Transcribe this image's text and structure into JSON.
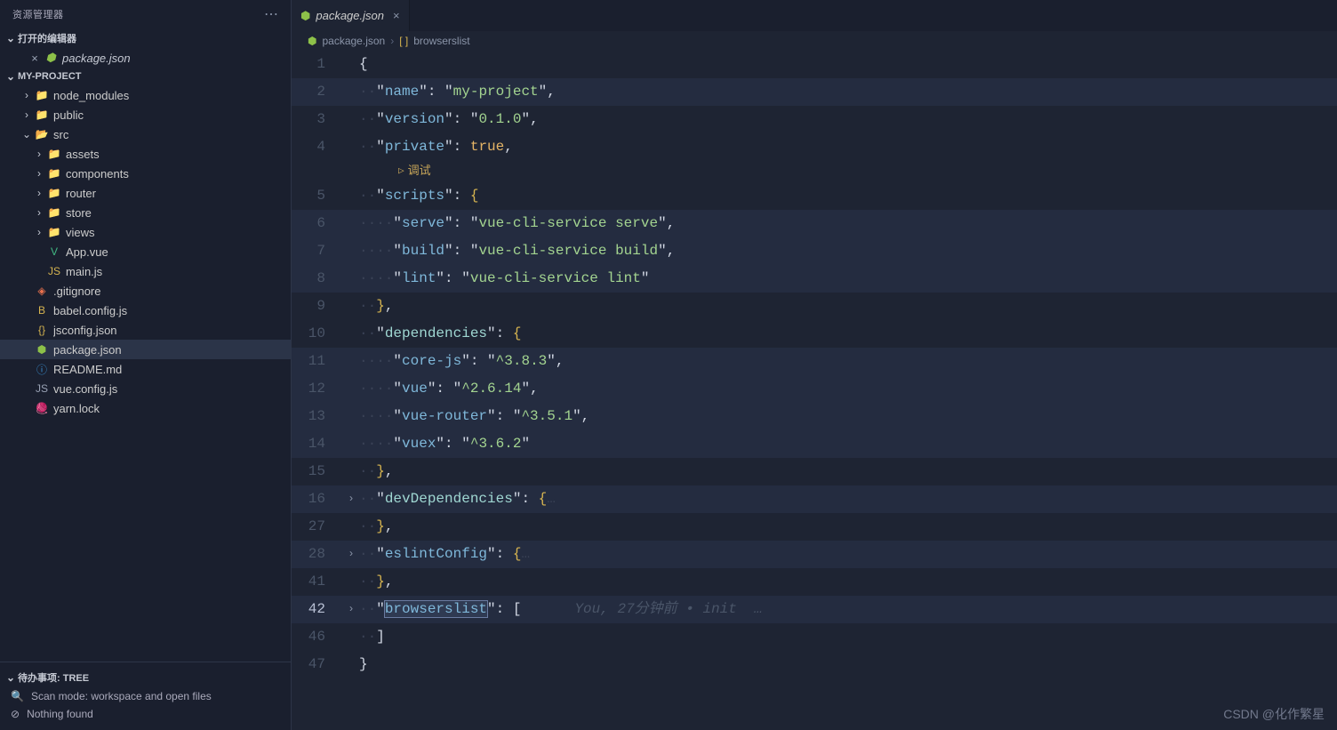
{
  "sidebar": {
    "title": "资源管理器",
    "open_editors_label": "打开的编辑器",
    "open_editor_file": "package.json",
    "project_name": "MY-PROJECT",
    "tree": [
      {
        "indent": 1,
        "chev": ">",
        "icon": "folder",
        "color": "#55b581",
        "label": "node_modules"
      },
      {
        "indent": 1,
        "chev": ">",
        "icon": "folder",
        "color": "#3a93d6",
        "label": "public"
      },
      {
        "indent": 1,
        "chev": "v",
        "icon": "folder-open",
        "color": "#55b581",
        "label": "src"
      },
      {
        "indent": 2,
        "chev": ">",
        "icon": "folder",
        "color": "#d6b450",
        "label": "assets"
      },
      {
        "indent": 2,
        "chev": ">",
        "icon": "folder",
        "color": "#d6b450",
        "label": "components"
      },
      {
        "indent": 2,
        "chev": ">",
        "icon": "folder",
        "color": "#55b581",
        "label": "router"
      },
      {
        "indent": 2,
        "chev": ">",
        "icon": "folder",
        "color": "#d6b450",
        "label": "store"
      },
      {
        "indent": 2,
        "chev": ">",
        "icon": "folder",
        "color": "#d6b450",
        "label": "views"
      },
      {
        "indent": 2,
        "chev": "",
        "icon": "vue",
        "color": "#41b883",
        "label": "App.vue"
      },
      {
        "indent": 2,
        "chev": "",
        "icon": "js",
        "color": "#d6b450",
        "label": "main.js"
      },
      {
        "indent": 1,
        "chev": "",
        "icon": "git",
        "color": "#e8714d",
        "label": ".gitignore"
      },
      {
        "indent": 1,
        "chev": "",
        "icon": "babel",
        "color": "#d6b450",
        "label": "babel.config.js"
      },
      {
        "indent": 1,
        "chev": "",
        "icon": "json",
        "color": "#d6b450",
        "label": "jsconfig.json"
      },
      {
        "indent": 1,
        "chev": "",
        "icon": "npm",
        "color": "#8dc149",
        "label": "package.json",
        "selected": true
      },
      {
        "indent": 1,
        "chev": "",
        "icon": "readme",
        "color": "#3a93d6",
        "label": "README.md"
      },
      {
        "indent": 1,
        "chev": "",
        "icon": "js",
        "color": "#9aa3b5",
        "label": "vue.config.js"
      },
      {
        "indent": 1,
        "chev": "",
        "icon": "yarn",
        "color": "#3a93d6",
        "label": "yarn.lock"
      }
    ],
    "footer": {
      "pending_label": "待办事项: TREE",
      "scan_label": "Scan mode: workspace and open files",
      "nothing_label": "Nothing found"
    }
  },
  "editor": {
    "tab_label": "package.json",
    "breadcrumb_file": "package.json",
    "breadcrumb_symbol": "browserslist",
    "codelens_debug": "调试",
    "blame": "You, 27分钟前 • init  …",
    "lines": [
      {
        "n": "1",
        "fold": "",
        "tokens": [
          [
            "punc",
            "{"
          ]
        ]
      },
      {
        "n": "2",
        "fold": "",
        "hl": true,
        "tokens": [
          [
            "ws",
            "··"
          ],
          [
            "punc",
            "\""
          ],
          [
            "key",
            "name"
          ],
          [
            "punc",
            "\": "
          ],
          [
            "punc",
            "\""
          ],
          [
            "str",
            "my-project"
          ],
          [
            "punc",
            "\","
          ]
        ]
      },
      {
        "n": "3",
        "fold": "",
        "tokens": [
          [
            "ws",
            "··"
          ],
          [
            "punc",
            "\""
          ],
          [
            "key",
            "version"
          ],
          [
            "punc",
            "\": "
          ],
          [
            "punc",
            "\""
          ],
          [
            "str",
            "0.1.0"
          ],
          [
            "punc",
            "\","
          ]
        ]
      },
      {
        "n": "4",
        "fold": "",
        "tokens": [
          [
            "ws",
            "··"
          ],
          [
            "punc",
            "\""
          ],
          [
            "key",
            "private"
          ],
          [
            "punc",
            "\": "
          ],
          [
            "bool",
            "true"
          ],
          [
            "punc",
            ","
          ]
        ]
      },
      {
        "codelens": true
      },
      {
        "n": "5",
        "fold": "",
        "tokens": [
          [
            "ws",
            "··"
          ],
          [
            "punc",
            "\""
          ],
          [
            "key",
            "scripts"
          ],
          [
            "punc",
            "\": "
          ],
          [
            "brace",
            "{"
          ]
        ]
      },
      {
        "n": "6",
        "fold": "",
        "hl": true,
        "tokens": [
          [
            "ws",
            "····"
          ],
          [
            "punc",
            "\""
          ],
          [
            "key",
            "serve"
          ],
          [
            "punc",
            "\": "
          ],
          [
            "punc",
            "\""
          ],
          [
            "str",
            "vue-cli-service serve"
          ],
          [
            "punc",
            "\","
          ]
        ]
      },
      {
        "n": "7",
        "fold": "",
        "hl": true,
        "tokens": [
          [
            "ws",
            "····"
          ],
          [
            "punc",
            "\""
          ],
          [
            "key",
            "build"
          ],
          [
            "punc",
            "\": "
          ],
          [
            "punc",
            "\""
          ],
          [
            "str",
            "vue-cli-service build"
          ],
          [
            "punc",
            "\","
          ]
        ]
      },
      {
        "n": "8",
        "fold": "",
        "hl": true,
        "tokens": [
          [
            "ws",
            "····"
          ],
          [
            "punc",
            "\""
          ],
          [
            "key",
            "lint"
          ],
          [
            "punc",
            "\": "
          ],
          [
            "punc",
            "\""
          ],
          [
            "str",
            "vue-cli-service lint"
          ],
          [
            "punc",
            "\""
          ]
        ]
      },
      {
        "n": "9",
        "fold": "",
        "tokens": [
          [
            "ws",
            "··"
          ],
          [
            "brace",
            "}"
          ],
          [
            "punc",
            ","
          ]
        ]
      },
      {
        "n": "10",
        "fold": "",
        "tokens": [
          [
            "ws",
            "··"
          ],
          [
            "punc",
            "\""
          ],
          [
            "kw-dep",
            "dependencies"
          ],
          [
            "punc",
            "\": "
          ],
          [
            "brace",
            "{"
          ]
        ]
      },
      {
        "n": "11",
        "fold": "",
        "hl": true,
        "tokens": [
          [
            "ws",
            "····"
          ],
          [
            "punc",
            "\""
          ],
          [
            "key",
            "core-js"
          ],
          [
            "punc",
            "\": "
          ],
          [
            "punc",
            "\""
          ],
          [
            "str",
            "^3.8.3"
          ],
          [
            "punc",
            "\","
          ]
        ]
      },
      {
        "n": "12",
        "fold": "",
        "hl": true,
        "tokens": [
          [
            "ws",
            "····"
          ],
          [
            "punc",
            "\""
          ],
          [
            "key",
            "vue"
          ],
          [
            "punc",
            "\": "
          ],
          [
            "punc",
            "\""
          ],
          [
            "str",
            "^2.6.14"
          ],
          [
            "punc",
            "\","
          ]
        ]
      },
      {
        "n": "13",
        "fold": "",
        "hl": true,
        "tokens": [
          [
            "ws",
            "····"
          ],
          [
            "punc",
            "\""
          ],
          [
            "key",
            "vue-router"
          ],
          [
            "punc",
            "\": "
          ],
          [
            "punc",
            "\""
          ],
          [
            "str",
            "^3.5.1"
          ],
          [
            "punc",
            "\","
          ]
        ]
      },
      {
        "n": "14",
        "fold": "",
        "hl": true,
        "tokens": [
          [
            "ws",
            "····"
          ],
          [
            "punc",
            "\""
          ],
          [
            "key",
            "vuex"
          ],
          [
            "punc",
            "\": "
          ],
          [
            "punc",
            "\""
          ],
          [
            "str",
            "^3.6.2"
          ],
          [
            "punc",
            "\""
          ]
        ]
      },
      {
        "n": "15",
        "fold": "",
        "tokens": [
          [
            "ws",
            "··"
          ],
          [
            "brace",
            "}"
          ],
          [
            "punc",
            ","
          ]
        ]
      },
      {
        "n": "16",
        "fold": ">",
        "hl": true,
        "tokens": [
          [
            "ws",
            "··"
          ],
          [
            "punc",
            "\""
          ],
          [
            "kw-dep",
            "devDependencies"
          ],
          [
            "punc",
            "\": "
          ],
          [
            "brace",
            "{"
          ],
          [
            "ws",
            "…"
          ]
        ]
      },
      {
        "n": "27",
        "fold": "",
        "tokens": [
          [
            "ws",
            "··"
          ],
          [
            "brace",
            "}"
          ],
          [
            "punc",
            ","
          ]
        ]
      },
      {
        "n": "28",
        "fold": ">",
        "hl": true,
        "tokens": [
          [
            "ws",
            "··"
          ],
          [
            "punc",
            "\""
          ],
          [
            "key",
            "eslintConfig"
          ],
          [
            "punc",
            "\": "
          ],
          [
            "brace",
            "{"
          ],
          [
            "ws",
            "…"
          ]
        ]
      },
      {
        "n": "41",
        "fold": "",
        "tokens": [
          [
            "ws",
            "··"
          ],
          [
            "brace",
            "}"
          ],
          [
            "punc",
            ","
          ]
        ]
      },
      {
        "n": "42",
        "fold": ">",
        "hl": true,
        "cursor": true,
        "tokens": [
          [
            "ws",
            "··"
          ],
          [
            "punc",
            "\""
          ],
          [
            "key-cursor",
            "browserslist"
          ],
          [
            "punc",
            "\": "
          ],
          [
            "punc",
            "["
          ]
        ],
        "blame": true
      },
      {
        "n": "46",
        "fold": "",
        "tokens": [
          [
            "ws",
            "··"
          ],
          [
            "punc",
            "]"
          ]
        ]
      },
      {
        "n": "47",
        "fold": "",
        "tokens": [
          [
            "punc",
            "}"
          ]
        ]
      }
    ]
  },
  "watermark": "CSDN @化作繁星"
}
